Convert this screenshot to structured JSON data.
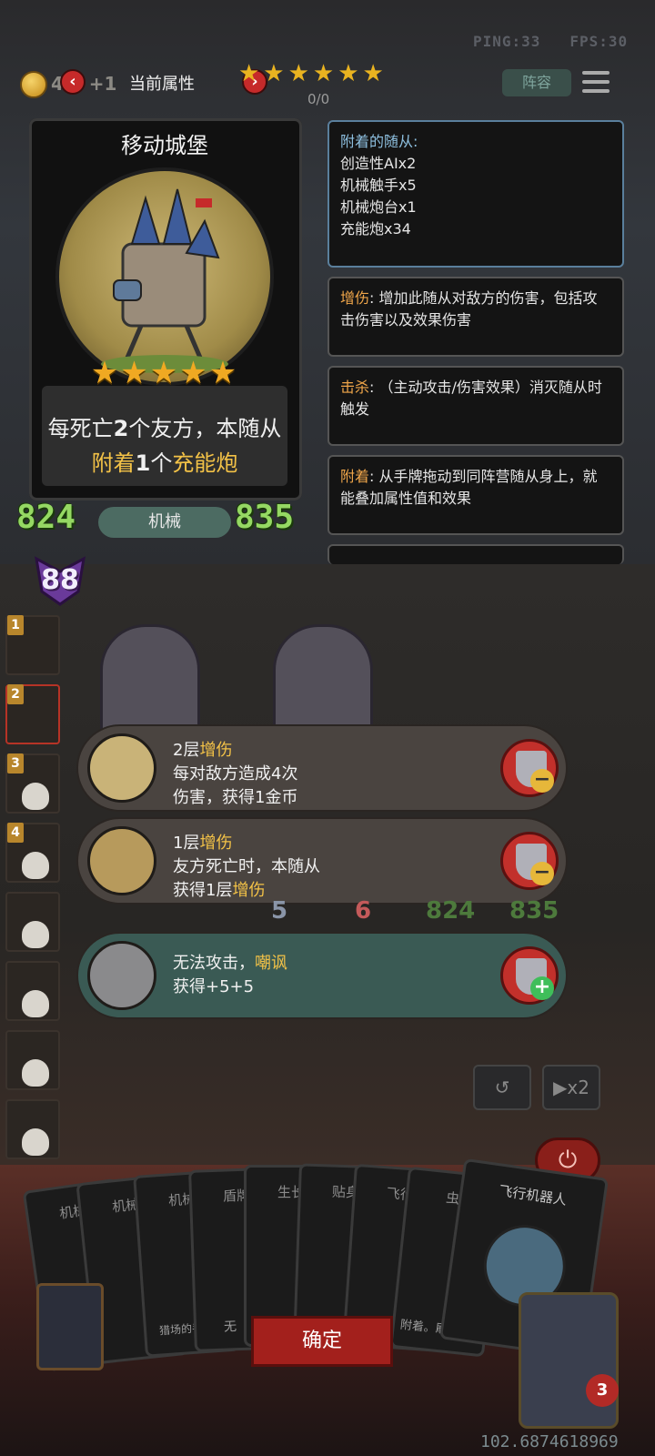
{
  "status": {
    "ping": "PING:33",
    "fps": "FPS:30"
  },
  "header": {
    "gold": "4 5 +1",
    "title": "当前属性",
    "stars": "★★★★★★",
    "counter": "0/0",
    "lineup_label": "阵容"
  },
  "unit_card": {
    "name": "移动城堡",
    "stars": "★★★★★",
    "desc_pre": "每死亡",
    "desc_num1": "2",
    "desc_mid": "个友方，本随从",
    "desc_attach": "附着",
    "desc_num2": "1",
    "desc_ge": "个",
    "desc_item": "充能炮",
    "attack": "824",
    "health": "835",
    "tribe": "机械",
    "gem_value": "88"
  },
  "info_panels": {
    "attached_title": "附着的随从:",
    "attached": [
      "创造性AIx2",
      "机械触手x5",
      "机械炮台x1",
      "充能炮x34"
    ],
    "damage_label": "增伤",
    "damage_text": ": 增加此随从对敌方的伤害，包括攻击伤害以及效果伤害",
    "kill_label": "击杀",
    "kill_text": ": （主动攻击/伤害效果）消灭随从时触发",
    "attach_label": "附着",
    "attach_text": ": 从手牌拖动到同阵营随从身上，就能叠加属性值和效果"
  },
  "roster": [
    "1",
    "2",
    "3",
    "4"
  ],
  "effects": [
    {
      "level": "2层",
      "keyword": "增伤",
      "line2": "每对敌方造成4次",
      "line3": "伤害，获得1金币"
    },
    {
      "level": "1层",
      "keyword": "增伤",
      "line2": "友方死亡时，本随从",
      "line3_pre": "获得1层",
      "line3_kw": "增伤"
    },
    {
      "line1_pre": "无法攻击，",
      "line1_kw": "嘲讽",
      "line2": "获得+5+5"
    }
  ],
  "board_stats": {
    "a": "5",
    "b": "6",
    "atk": "824",
    "hp": "835"
  },
  "controls": {
    "speed": "▶x2",
    "undo": "↺",
    "power": "⏻"
  },
  "hand": [
    "机械",
    "机械",
    "机械",
    "盾牌",
    "生长",
    "贴身",
    "飞行",
    "虫",
    "飞行机器人"
  ],
  "hand_snippets": {
    "c1": "猎场的手牌",
    "c2": "无",
    "c3": "着",
    "c4": "附着。刷"
  },
  "confirm_label": "确定",
  "lives": "3",
  "coords": "102.6874618969"
}
